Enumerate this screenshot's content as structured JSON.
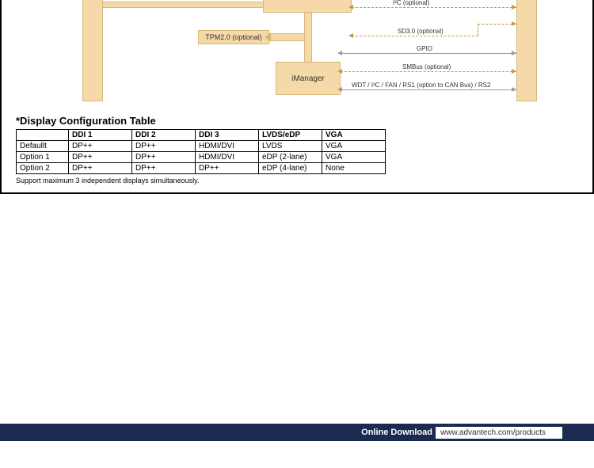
{
  "diagram": {
    "tpm_label": "TPM2.0 (optional)",
    "imanager_label": "iManager",
    "buses": {
      "i2c": "I²C (optional)",
      "sd30": "SD3.0 (optional)",
      "gpio": "GPIO",
      "smbus": "SMBus (optional)",
      "wdt": "WDT / I²C / FAN / RS1 (option to CAN Bus) / RS2"
    }
  },
  "table": {
    "title": "*Display Configuration Table",
    "headers": [
      "",
      "DDI 1",
      "DDI 2",
      "DDI 3",
      "LVDS/eDP",
      "VGA"
    ],
    "rows": [
      [
        "Defaullt",
        "DP++",
        "DP++",
        "HDMI/DVI",
        "LVDS",
        "VGA"
      ],
      [
        "Option 1",
        "DP++",
        "DP++",
        "HDMI/DVI",
        "eDP (2-lane)",
        "VGA"
      ],
      [
        "Option 2",
        "DP++",
        "DP++",
        "DP++",
        "eDP (4-lane)",
        "None"
      ]
    ],
    "footnote": "Support maximum 3 independent displays simultaneously."
  },
  "footer": {
    "label": "Online Download",
    "url": "www.advantech.com/products"
  }
}
